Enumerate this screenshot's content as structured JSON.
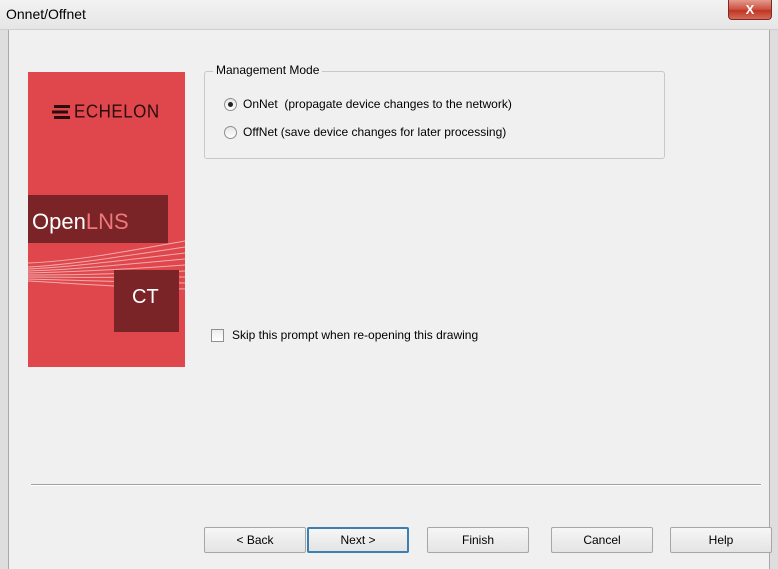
{
  "window": {
    "title": "Onnet/Offnet",
    "close_glyph": "X"
  },
  "logo": {
    "brand": "ECHELON",
    "product_prefix": "Open",
    "product_suffix": "LNS",
    "edition": "CT"
  },
  "management_mode": {
    "legend": "Management Mode",
    "options": [
      {
        "label": "OnNet  (propagate device changes to the network)",
        "selected": true
      },
      {
        "label": "OffNet (save device changes for later processing)",
        "selected": false
      }
    ]
  },
  "skip_prompt": {
    "label": "Skip this prompt when re-opening this drawing",
    "checked": false
  },
  "buttons": {
    "back": "< Back",
    "next": "Next >",
    "finish": "Finish",
    "cancel": "Cancel",
    "help": "Help"
  },
  "colors": {
    "logo_red": "#e0474c",
    "logo_dark": "#7a2428",
    "default_button_border": "#3c7fb1"
  }
}
